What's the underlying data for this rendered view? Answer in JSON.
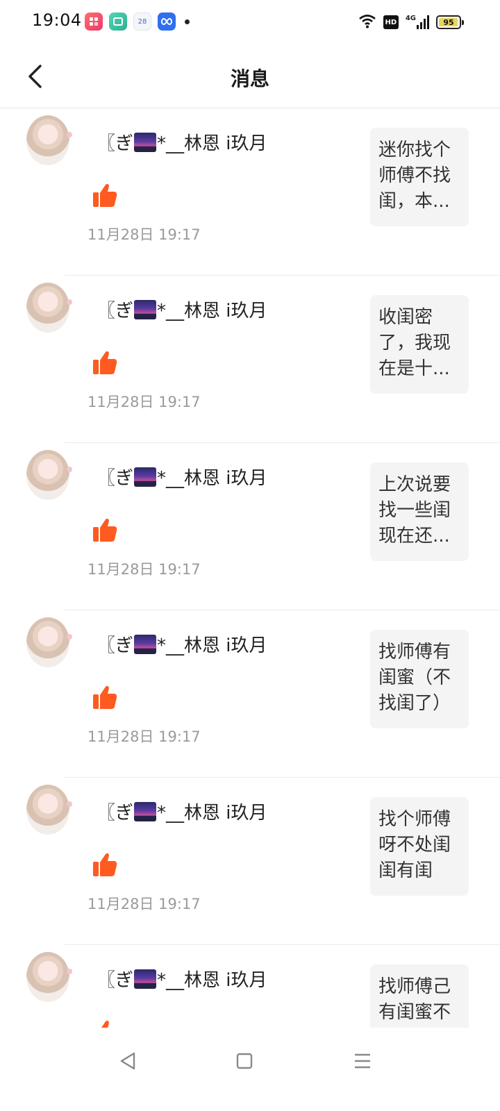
{
  "status_bar": {
    "time": "19:04",
    "notification_icons": [
      "app-icon-red",
      "app-icon-green",
      "calendar-icon",
      "infinity-app-icon"
    ],
    "calendar_day": "28",
    "network": "4G",
    "hd_label": "HD",
    "battery_level": "95",
    "battery_fraction": 0.95,
    "battery_color": "#e8d55a"
  },
  "header": {
    "title": "消息"
  },
  "messages": [
    {
      "username_prefix": "〖ぎ",
      "username_suffix": "*__林恩 i玖月",
      "timestamp": "11月28日 19:17",
      "preview": "迷你找个师傅不找闺，本..."
    },
    {
      "username_prefix": "〖ぎ",
      "username_suffix": "*__林恩 i玖月",
      "timestamp": "11月28日 19:17",
      "preview": "收闺密了，我现在是十..."
    },
    {
      "username_prefix": "〖ぎ",
      "username_suffix": "*__林恩 i玖月",
      "timestamp": "11月28日 19:17",
      "preview": "上次说要找一些闺现在还..."
    },
    {
      "username_prefix": "〖ぎ",
      "username_suffix": "*__林恩 i玖月",
      "timestamp": "11月28日 19:17",
      "preview": "找师傅有闺蜜（不找闺了）"
    },
    {
      "username_prefix": "〖ぎ",
      "username_suffix": "*__林恩 i玖月",
      "timestamp": "11月28日 19:17",
      "preview": "找个师傅呀不处闺闺有闺"
    },
    {
      "username_prefix": "〖ぎ",
      "username_suffix": "*__林恩 i玖月",
      "timestamp": "",
      "preview": "找师傅己有闺蜜不"
    }
  ],
  "colors": {
    "like": "#ff5a1f",
    "preview_bg": "#f4f4f4",
    "timestamp": "#9a9a9a"
  },
  "nav_bar": {
    "buttons": [
      "back-triangle-icon",
      "home-square-icon",
      "menu-lines-icon"
    ]
  }
}
